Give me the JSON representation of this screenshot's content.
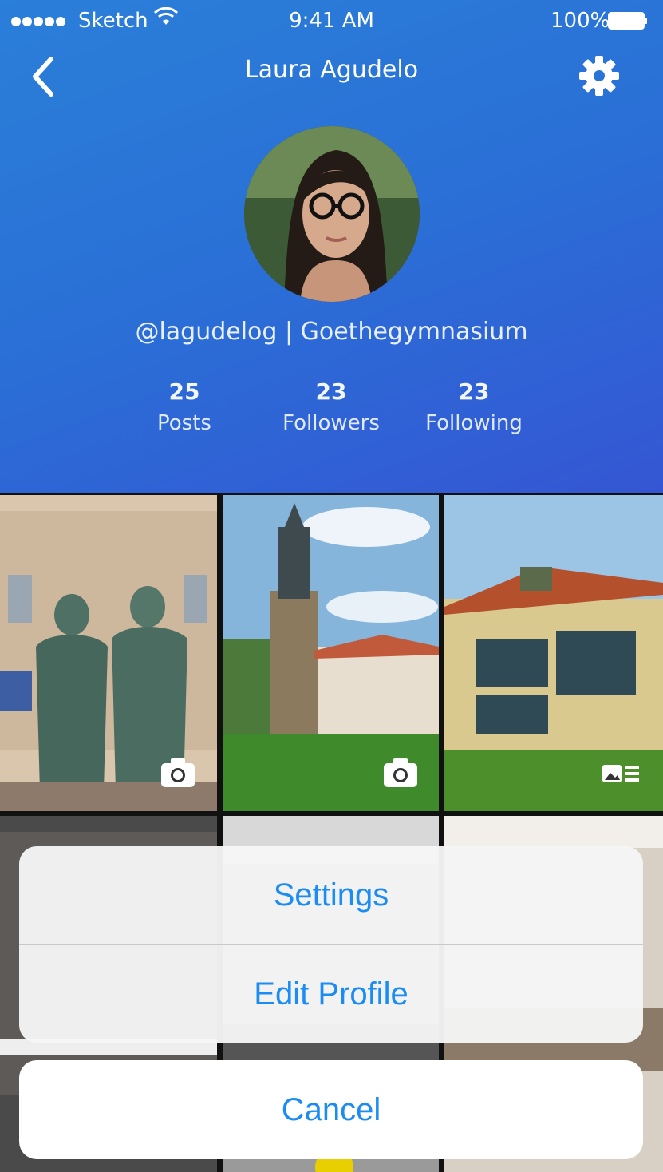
{
  "status_bar": {
    "carrier": "Sketch",
    "time": "9:41 AM",
    "battery": "100%"
  },
  "nav": {
    "title": "Laura Agudelo",
    "back_icon": "chevron-left-icon",
    "settings_icon": "gear-icon"
  },
  "profile": {
    "handle_line": "@lagudelog | Goethegymnasium",
    "stats": [
      {
        "value": "25",
        "label": "Posts"
      },
      {
        "value": "23",
        "label": "Followers"
      },
      {
        "value": "23",
        "label": "Following"
      }
    ]
  },
  "grid": {
    "photos": [
      {
        "badge": "camera-icon"
      },
      {
        "badge": "camera-icon"
      },
      {
        "badge": "article-icon"
      },
      {
        "badge": ""
      },
      {
        "badge": ""
      },
      {
        "badge": ""
      }
    ]
  },
  "action_sheet": {
    "items": [
      "Settings",
      "Edit Profile"
    ],
    "cancel": "Cancel"
  },
  "colors": {
    "header_top": "#2a7fd9",
    "header_bottom": "#3556d4",
    "action_blue": "#1a8cf3"
  }
}
